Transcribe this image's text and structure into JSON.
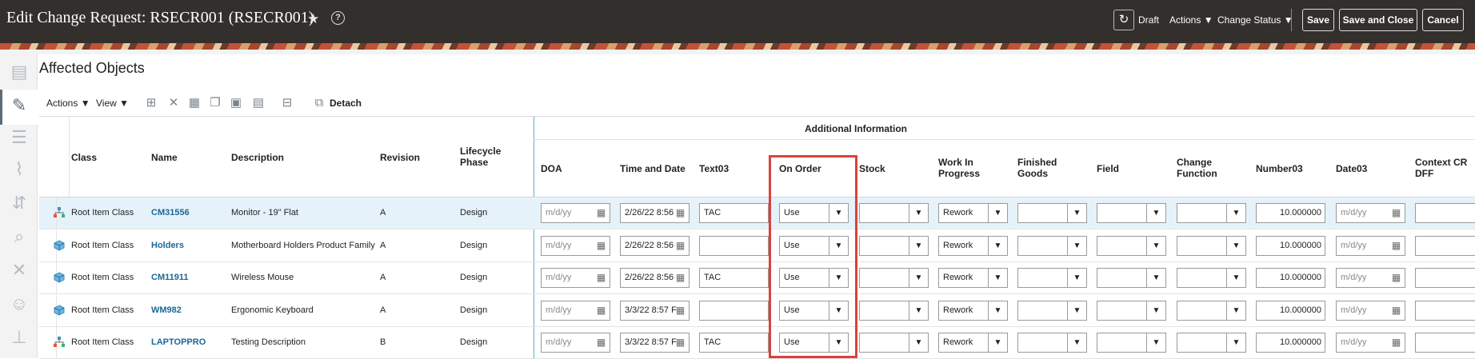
{
  "header": {
    "title": "Edit Change Request: RSECR001 (RSECR001)",
    "status": "Draft",
    "actions_label": "Actions",
    "change_status_label": "Change Status",
    "save_label": "Save",
    "save_close_label": "Save and Close",
    "cancel_label": "Cancel"
  },
  "section": {
    "title": "Affected Objects",
    "toolbar": {
      "actions": "Actions",
      "view": "View",
      "detach": "Detach"
    }
  },
  "table": {
    "group_header": "Additional Information",
    "columns": {
      "class": "Class",
      "name": "Name",
      "description": "Description",
      "revision": "Revision",
      "lifecycle_line1": "Lifecycle",
      "lifecycle_line2": "Phase",
      "doa": "DOA",
      "time_date": "Time and Date",
      "text03": "Text03",
      "on_order": "On Order",
      "stock": "Stock",
      "wip_line1": "Work In",
      "wip_line2": "Progress",
      "finished_line1": "Finished",
      "finished_line2": "Goods",
      "field": "Field",
      "change_fn_line1": "Change",
      "change_fn_line2": "Function",
      "number03": "Number03",
      "date03": "Date03",
      "context_line1": "Context CR",
      "context_line2": "DFF"
    },
    "date_placeholder": "m/d/yy",
    "rows": [
      {
        "class": "Root Item Class",
        "name": "CM31556",
        "description": "Monitor - 19\" Flat",
        "revision": "A",
        "lifecycle": "Design",
        "time_date": "2/26/22 8:56",
        "text03": "TAC",
        "on_order": "Use",
        "wip": "Rework",
        "number03": "10.000000"
      },
      {
        "class": "Root Item Class",
        "name": "Holders",
        "description": "Motherboard Holders Product Family",
        "revision": "A",
        "lifecycle": "Design",
        "time_date": "2/26/22 8:56",
        "text03": "",
        "on_order": "Use",
        "wip": "Rework",
        "number03": "10.000000"
      },
      {
        "class": "Root Item Class",
        "name": "CM11911",
        "description": "Wireless Mouse",
        "revision": "A",
        "lifecycle": "Design",
        "time_date": "2/26/22 8:56",
        "text03": "TAC",
        "on_order": "Use",
        "wip": "Rework",
        "number03": "10.000000"
      },
      {
        "class": "Root Item Class",
        "name": "WM982",
        "description": "Ergonomic Keyboard",
        "revision": "A",
        "lifecycle": "Design",
        "time_date": "3/3/22 8:57 F",
        "text03": "",
        "on_order": "Use",
        "wip": "Rework",
        "number03": "10.000000"
      },
      {
        "class": "Root Item Class",
        "name": "LAPTOPPRO",
        "description": "Testing Description",
        "revision": "B",
        "lifecycle": "Design",
        "time_date": "3/3/22 8:57 F",
        "text03": "TAC",
        "on_order": "Use",
        "wip": "Rework",
        "number03": "10.000000"
      }
    ]
  },
  "colors": {
    "header_bg": "#332f2c",
    "link": "#1a6896",
    "highlight": "#d9423b",
    "selected_row": "#e6f2fa"
  }
}
